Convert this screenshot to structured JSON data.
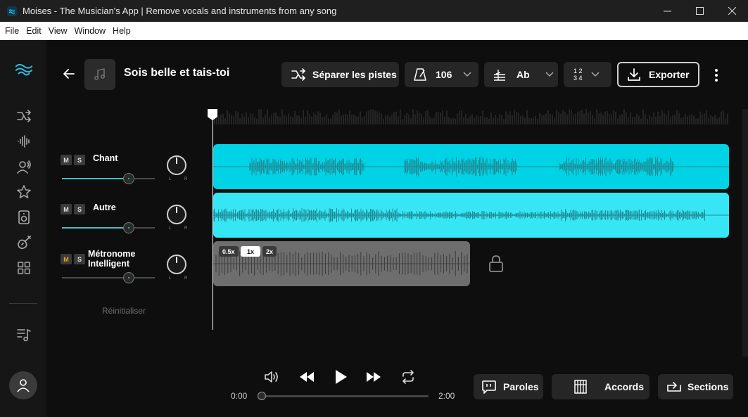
{
  "window": {
    "title": "Moises - The Musician's App | Remove vocals and instruments from any song",
    "minimize": "—",
    "maximize": "☐",
    "close": "✕"
  },
  "menu": [
    "File",
    "Edit",
    "View",
    "Window",
    "Help"
  ],
  "sidebar": {
    "icons": [
      "moises-logo-icon",
      "separate-icon",
      "waveform-icon",
      "voice-icon",
      "star-icon",
      "speaker-icon",
      "guitar-icon",
      "apps-icon",
      "playlist-icon",
      "user-icon"
    ]
  },
  "song": {
    "title": "Sois belle et tais-toi"
  },
  "toolbar": {
    "separate_label": "Séparer les pistes",
    "bpm": "106",
    "key": "Ab",
    "time_sig_top": "1 2",
    "time_sig_bottom": "3 4",
    "export_label": "Exporter"
  },
  "tracks": [
    {
      "m": "M",
      "s": "S",
      "name": "Chant",
      "volume": 0.72,
      "pan_l": "L",
      "pan_r": "R",
      "color": "#00d3e6"
    },
    {
      "m": "M",
      "s": "S",
      "name": "Autre",
      "volume": 0.72,
      "pan_l": "L",
      "pan_r": "R",
      "color": "#37e6f5"
    },
    {
      "m": "M",
      "s": "S",
      "name": "Métronome",
      "name2": "Intelligent",
      "volume": 0.72,
      "pan_l": "L",
      "pan_r": "R",
      "color": "#6e6e6e"
    }
  ],
  "reset_label": "Réinitialiser",
  "metronome_speeds": [
    {
      "label": "0.5x",
      "active": false
    },
    {
      "label": "1x",
      "active": true
    },
    {
      "label": "2x",
      "active": false
    }
  ],
  "transport": {
    "time_start": "0:00",
    "time_end": "2:00",
    "progress": 0.0
  },
  "bottom_buttons": {
    "lyrics": "Paroles",
    "chords": "Accords",
    "sections": "Sections"
  },
  "colors": {
    "accent": "#00d3e6",
    "wave_dark": "#1f8a93"
  }
}
